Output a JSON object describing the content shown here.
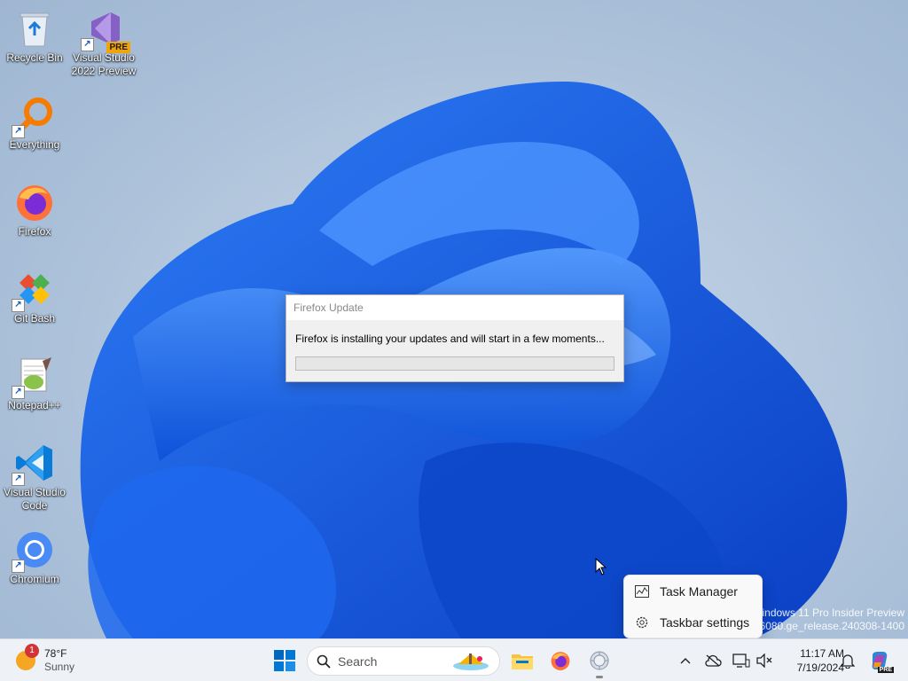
{
  "desktop": {
    "icons": [
      {
        "label": "Recycle Bin",
        "icon": "recycle-bin-icon"
      },
      {
        "label": "Visual Studio 2022 Preview",
        "icon": "visual-studio-icon",
        "badge": "PRE"
      },
      {
        "label": "Everything",
        "icon": "everything-search-icon"
      },
      {
        "label": "Firefox",
        "icon": "firefox-icon"
      },
      {
        "label": "Git Bash",
        "icon": "git-bash-icon"
      },
      {
        "label": "Notepad++",
        "icon": "notepad-plus-plus-icon"
      },
      {
        "label": "Visual Studio Code",
        "icon": "vscode-icon"
      },
      {
        "label": "Chromium",
        "icon": "chromium-icon"
      }
    ]
  },
  "dialog": {
    "title": "Firefox Update",
    "message": "Firefox is installing your updates and will start in a few moments...",
    "progress": 0
  },
  "context_menu": {
    "items": [
      {
        "label": "Task Manager",
        "icon": "task-manager-icon"
      },
      {
        "label": "Taskbar settings",
        "icon": "gear-icon"
      }
    ]
  },
  "watermark": {
    "line1": "Windows 11 Pro Insider Preview",
    "line2": "Evaluation copy. Build 26080.ge_release.240308-1400"
  },
  "taskbar": {
    "weather": {
      "temp": "78°F",
      "condition": "Sunny",
      "badge": "1"
    },
    "search_placeholder": "Search",
    "clock": {
      "time": "11:17 AM",
      "date": "7/19/2024"
    },
    "copilot_badge": "PRE"
  },
  "colors": {
    "accent": "#0067c0",
    "progress": "#06b025"
  }
}
